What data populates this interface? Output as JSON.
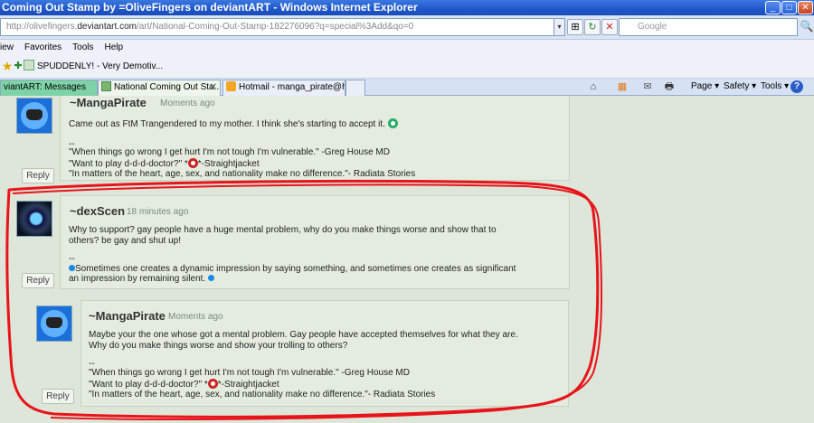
{
  "window": {
    "title": "Coming Out Stamp by =OliveFingers on deviantART - Windows Internet Explorer",
    "min_symbol": "_",
    "max_symbol": "□",
    "close_symbol": "✕"
  },
  "address": {
    "prefix": "http://olivefingers.",
    "domain": "deviantart.com",
    "path": "/art/National-Coming-Out-Stamp-182276096?q=special%3Add&qo=0",
    "dropdown": "▾"
  },
  "nav_buttons": [
    "⊞",
    "↻",
    "✕"
  ],
  "search": {
    "placeholder": "Google",
    "go": "🔍"
  },
  "menu": [
    "iew",
    "Favorites",
    "Tools",
    "Help"
  ],
  "favorites": {
    "link_label": "SPUDDENLY! - Very Demotiv...",
    "star1": "★",
    "star2": "✚"
  },
  "tabs": [
    {
      "label": "viantART: Messages"
    },
    {
      "label": "National Coming Out Sta...",
      "close": "✕"
    },
    {
      "label": "Hotmail - manga_pirate@hot..."
    }
  ],
  "commandbar": {
    "home": "⌂",
    "feeds": "▦",
    "mail": "✉",
    "print": "🖶",
    "page": "Page ▾",
    "safety": "Safety ▾",
    "tools": "Tools ▾",
    "help": "?"
  },
  "comments": [
    {
      "author": "~MangaPirate",
      "time": "Moments ago",
      "line1": "Came out as FtM Trangendered to my mother. I think she's starting to accept it.",
      "sig": "--",
      "quote1": "\"When things go wrong I get hurt I'm not tough I'm vulnerable.\" -Greg House MD",
      "quote2a": "\"Want to play d-d-d-doctor?\" *",
      "quote2b": "*-Straightjacket",
      "quote3": "\"In matters of the heart, age, sex, and nationality make no difference.\"- Radiata Stories",
      "reply": "Reply"
    },
    {
      "author": "~dexScen",
      "time": "18 minutes ago",
      "line1": "Why to support? gay people have a huge mental problem, why do you make things worse and show that to",
      "line2": "others? be gay and shut up!",
      "sig": "--",
      "line3": "Sometimes one creates a dynamic impression by saying something, and sometimes one creates as significant",
      "line4": "an impression by remaining silent.",
      "reply": "Reply"
    },
    {
      "author": "~MangaPirate",
      "time": "Moments ago",
      "line1": "Maybe your the one whose got a mental problem. Gay people have accepted themselves for what they are.",
      "line2": "Why do you make things worse and show your trolling to others?",
      "sig": "--",
      "quote1": "\"When things go wrong I get hurt I'm not tough I'm vulnerable.\" -Greg House MD",
      "quote2a": "\"Want to play d-d-d-doctor?\" *",
      "quote2b": "*-Straightjacket",
      "quote3": "\"In matters of the heart, age, sex, and nationality make no difference.\"- Radiata Stories",
      "reply": "Reply"
    }
  ],
  "colors": {
    "highlight_circle": "#e8141c",
    "page_bg": "#dde6d8"
  }
}
